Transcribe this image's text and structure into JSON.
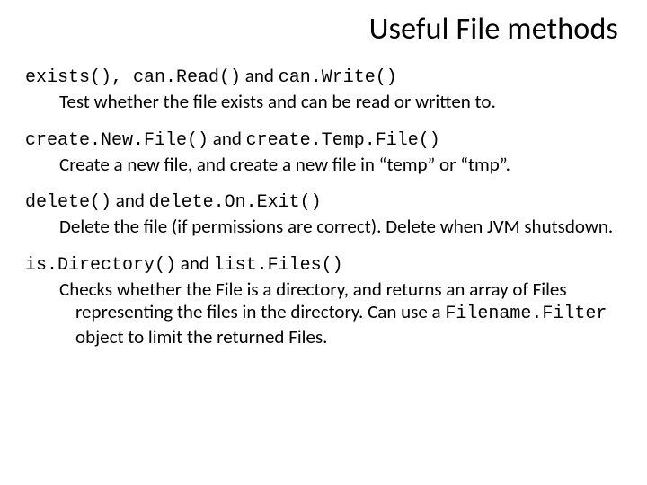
{
  "title": "Useful File methods",
  "sections": [
    {
      "h_code1": "exists()",
      "h_sep1": ", ",
      "h_code2": "can.Read()",
      "h_join": " and ",
      "h_code3": "can.Write()",
      "desc": "Test whether the file exists and can be read or written to."
    },
    {
      "h_code1": "create.New.File()",
      "h_join": " and ",
      "h_code2": "create.Temp.File()",
      "desc": "Create a new file, and create a new file in “temp” or “tmp”."
    },
    {
      "h_code1": "delete()",
      "h_join": " and ",
      "h_code2": "delete.On.Exit()",
      "desc": "Delete the file (if permissions are correct). Delete when JVM shutsdown."
    },
    {
      "h_code1": "is.Directory()",
      "h_join": " and ",
      "h_code2": "list.Files()",
      "desc_pre": "Checks whether the File is a directory, and returns an array of Files representing the files in the directory. Can use a ",
      "desc_code": "Filename.Filter",
      "desc_post": " object to limit the returned Files."
    }
  ]
}
